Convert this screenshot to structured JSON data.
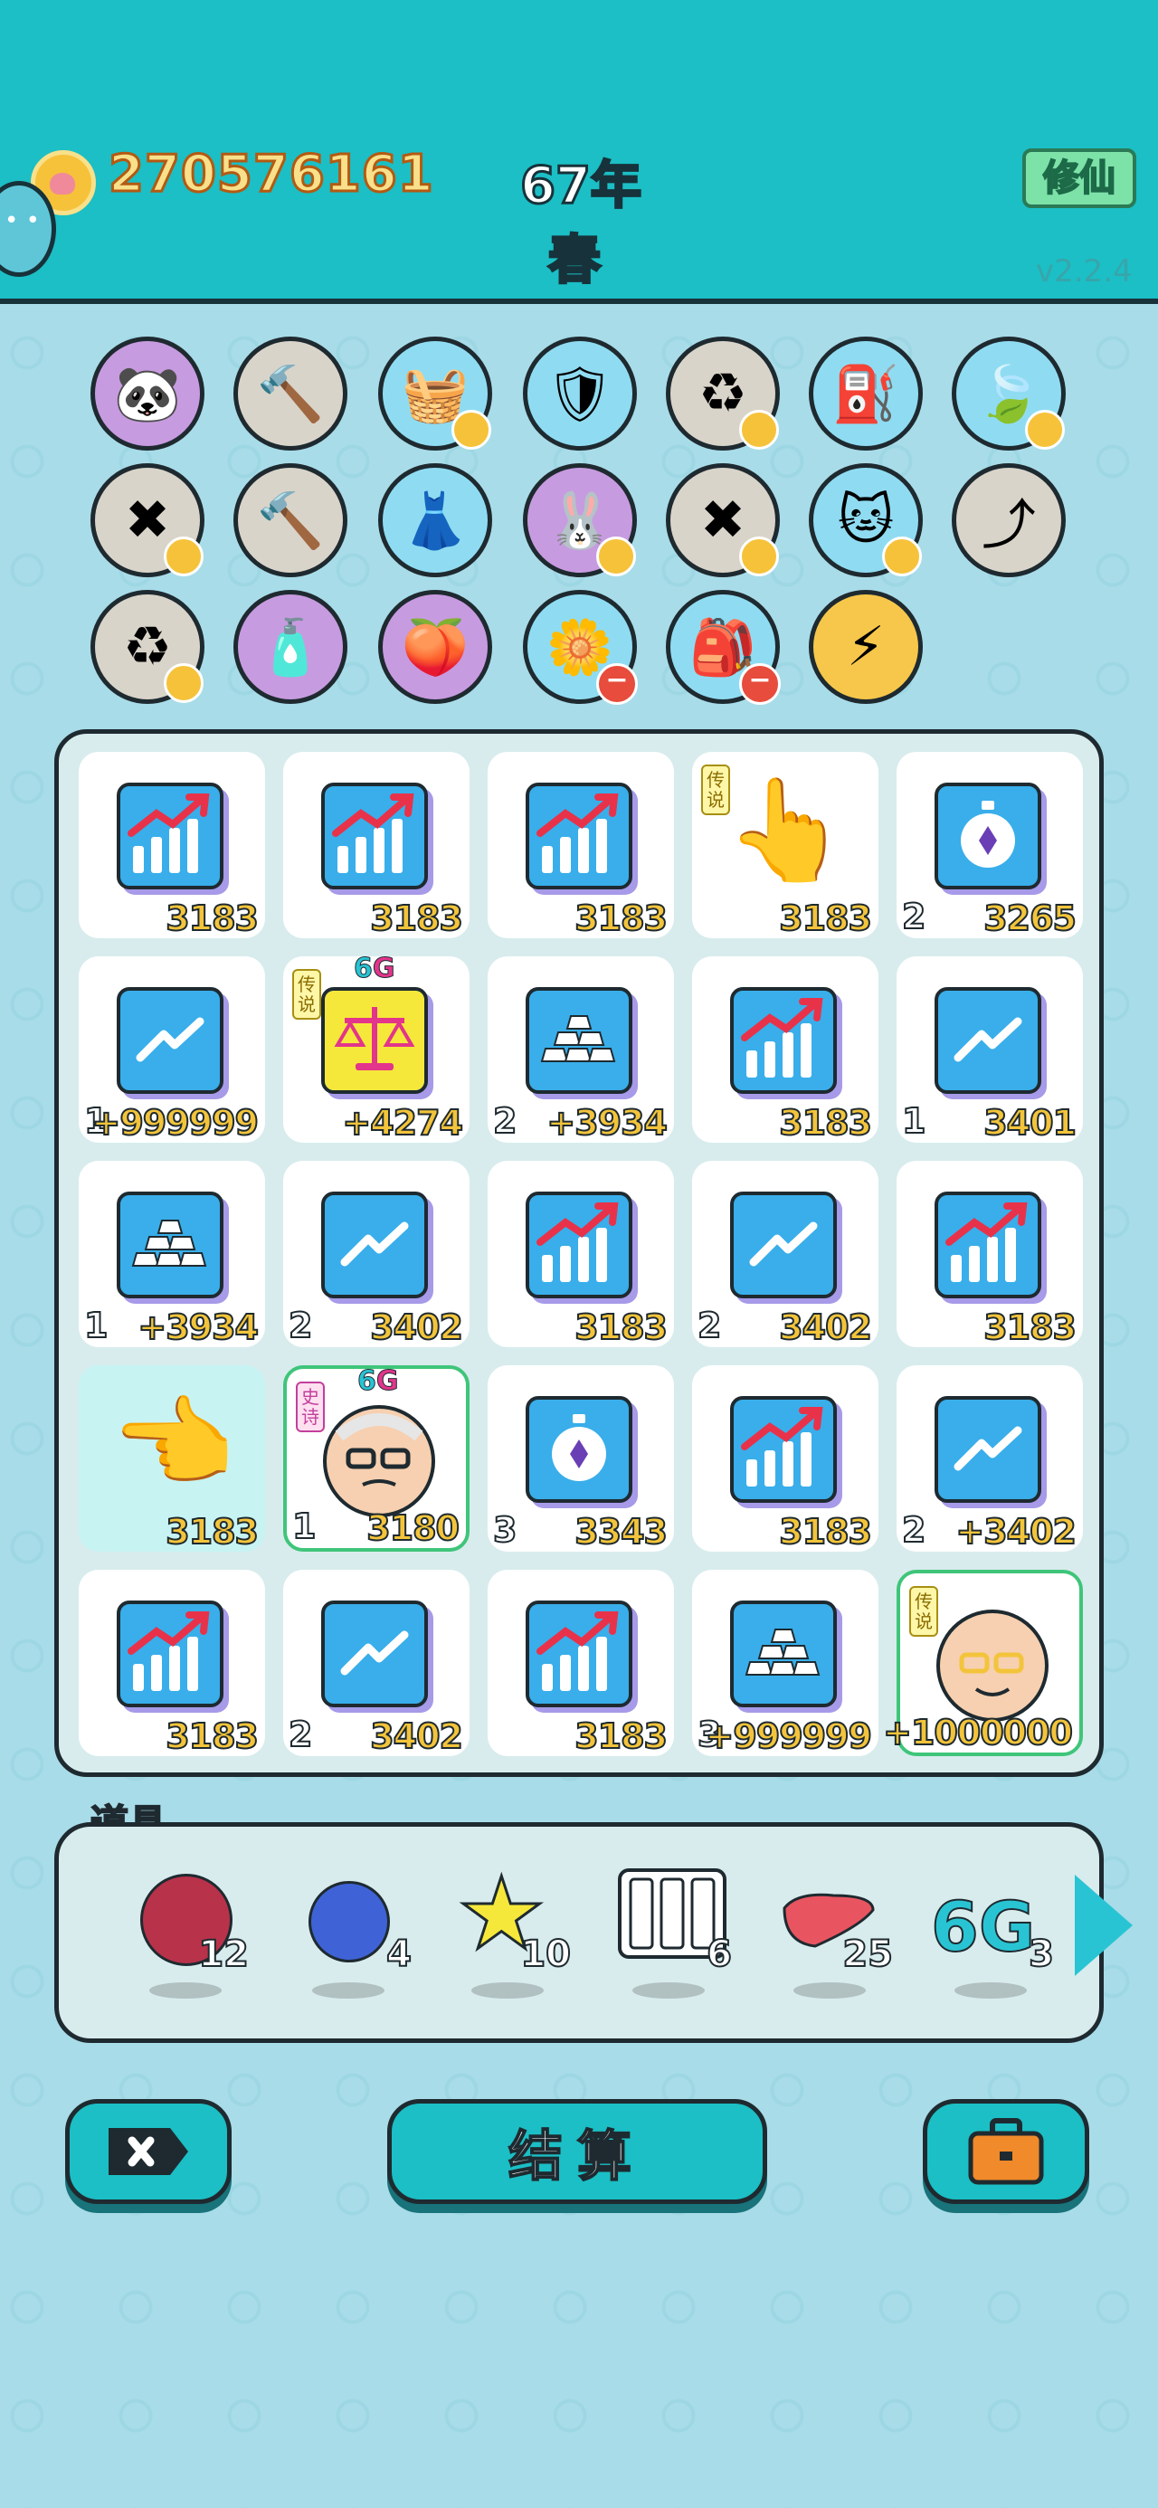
{
  "header": {
    "coins": "270576161",
    "year": "67年",
    "season": "春",
    "xiuxian_label": "修仙",
    "version": "v2.2.4"
  },
  "buffs": [
    {
      "name": "panda",
      "icon": "🐼",
      "bg": "purple",
      "badge": "none"
    },
    {
      "name": "hammer",
      "icon": "🔨",
      "bg": "gray",
      "badge": "none"
    },
    {
      "name": "fruit-basket",
      "icon": "🧺",
      "bg": "blue",
      "badge": "heart"
    },
    {
      "name": "shield",
      "icon": "🛡",
      "bg": "blue",
      "badge": "none"
    },
    {
      "name": "refresh",
      "icon": "♻",
      "bg": "gray",
      "badge": "heart"
    },
    {
      "name": "pump",
      "icon": "⛽",
      "bg": "blue",
      "badge": "none"
    },
    {
      "name": "leaf",
      "icon": "🍃",
      "bg": "blue",
      "badge": "heart"
    },
    {
      "name": "discard",
      "icon": "✖",
      "bg": "gray",
      "badge": "heart"
    },
    {
      "name": "hammer-2",
      "icon": "🔨",
      "bg": "gray",
      "badge": "none"
    },
    {
      "name": "skirt",
      "icon": "👗",
      "bg": "blue",
      "badge": "none"
    },
    {
      "name": "rabbit",
      "icon": "🐰",
      "bg": "purple",
      "badge": "heart"
    },
    {
      "name": "discard-2",
      "icon": "✖",
      "bg": "gray",
      "badge": "heart"
    },
    {
      "name": "cat",
      "icon": "🐱",
      "bg": "blue",
      "badge": "heart"
    },
    {
      "name": "arrow-card",
      "icon": "⤴",
      "bg": "gray",
      "badge": "none"
    },
    {
      "name": "refresh-2",
      "icon": "♻",
      "bg": "gray",
      "badge": "heart"
    },
    {
      "name": "spray",
      "icon": "🧴",
      "bg": "purple",
      "badge": "none"
    },
    {
      "name": "eyepatch",
      "icon": "🍑",
      "bg": "purple",
      "badge": "none"
    },
    {
      "name": "flower-pot",
      "icon": "🌼",
      "bg": "blue",
      "badge": "minus"
    },
    {
      "name": "sack",
      "icon": "🎒",
      "bg": "blue",
      "badge": "minus"
    },
    {
      "name": "lightning",
      "icon": "⚡",
      "bg": "yellow",
      "badge": "none"
    }
  ],
  "grid": [
    {
      "icon": "chart-up",
      "value": "3183",
      "level": ""
    },
    {
      "icon": "chart-up",
      "value": "3183",
      "level": ""
    },
    {
      "icon": "chart-up",
      "value": "3183",
      "level": ""
    },
    {
      "icon": "pointing-hand",
      "value": "3183",
      "level": "",
      "tag": "传说"
    },
    {
      "icon": "stopwatch",
      "value": "3265",
      "level": "2"
    },
    {
      "icon": "trend-line",
      "value": "+999999",
      "level": "1"
    },
    {
      "icon": "scales",
      "value": "+4274",
      "level": "",
      "tag": "传说",
      "badge6g": true
    },
    {
      "icon": "gold-bars",
      "value": "+3934",
      "level": "2"
    },
    {
      "icon": "chart-up",
      "value": "3183",
      "level": ""
    },
    {
      "icon": "trend-line",
      "value": "3401",
      "level": "1"
    },
    {
      "icon": "gold-bars",
      "value": "+3934",
      "level": "1"
    },
    {
      "icon": "trend-line",
      "value": "3402",
      "level": "2"
    },
    {
      "icon": "chart-up",
      "value": "3183",
      "level": ""
    },
    {
      "icon": "trend-line",
      "value": "3402",
      "level": "2"
    },
    {
      "icon": "chart-up",
      "value": "3183",
      "level": ""
    },
    {
      "icon": "pointing-hand-left",
      "value": "3183",
      "level": "",
      "highlight": true
    },
    {
      "icon": "old-man",
      "value": "3180",
      "level": "1",
      "tag": "史诗",
      "badge6g": true,
      "outlined": true
    },
    {
      "icon": "stopwatch",
      "value": "3343",
      "level": "3"
    },
    {
      "icon": "chart-up",
      "value": "3183",
      "level": ""
    },
    {
      "icon": "trend-line",
      "value": "+3402",
      "level": "2"
    },
    {
      "icon": "chart-up",
      "value": "3183",
      "level": ""
    },
    {
      "icon": "trend-line",
      "value": "3402",
      "level": "2"
    },
    {
      "icon": "chart-up",
      "value": "3183",
      "level": ""
    },
    {
      "icon": "gold-bars",
      "value": "+999999",
      "level": "3"
    },
    {
      "icon": "bald-man",
      "value": "+1000000",
      "level": "",
      "tag": "传说",
      "outlined": true
    }
  ],
  "sixg": {
    "six": "6",
    "g": "G"
  },
  "props": {
    "label": "道具",
    "items": [
      {
        "name": "lychee",
        "count": "12"
      },
      {
        "name": "blueberry",
        "count": "4"
      },
      {
        "name": "star",
        "count": "10"
      },
      {
        "name": "battery",
        "count": "6"
      },
      {
        "name": "liver",
        "count": "25"
      },
      {
        "name": "6g",
        "count": "3",
        "text": "6G"
      }
    ]
  },
  "buttons": {
    "settle": "结算"
  },
  "colors": {
    "accent": "#1bbfc5",
    "value_yellow": "#f3c43b",
    "outline": "#1e2a30"
  }
}
